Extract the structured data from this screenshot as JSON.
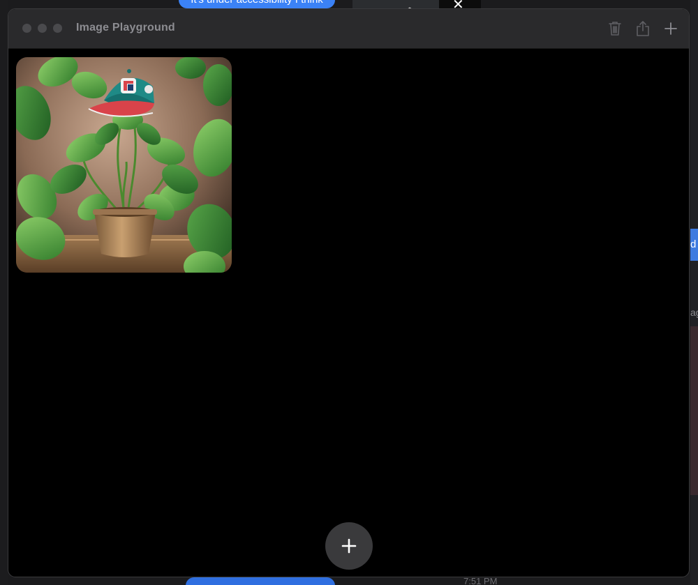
{
  "background": {
    "bubble_top_text": "It's under accessibility I think",
    "bubble_right_text": "d",
    "right_text": "ag",
    "time": "7:51 PM"
  },
  "window": {
    "title": "Image Playground",
    "toolbar": {
      "trash_icon": "trash-icon",
      "share_icon": "share-icon",
      "add_icon": "plus-icon"
    },
    "gallery": [
      {
        "description_icon": "generated-image-plant-with-baseball-cap"
      }
    ],
    "create_button_icon": "plus-icon"
  },
  "colors": {
    "window_bg": "#000000",
    "titlebar_bg": "#2a2a2c",
    "title_text": "#8d8d92",
    "fab_bg": "#3a3a3c",
    "accent_blue": "#3b82f6"
  }
}
